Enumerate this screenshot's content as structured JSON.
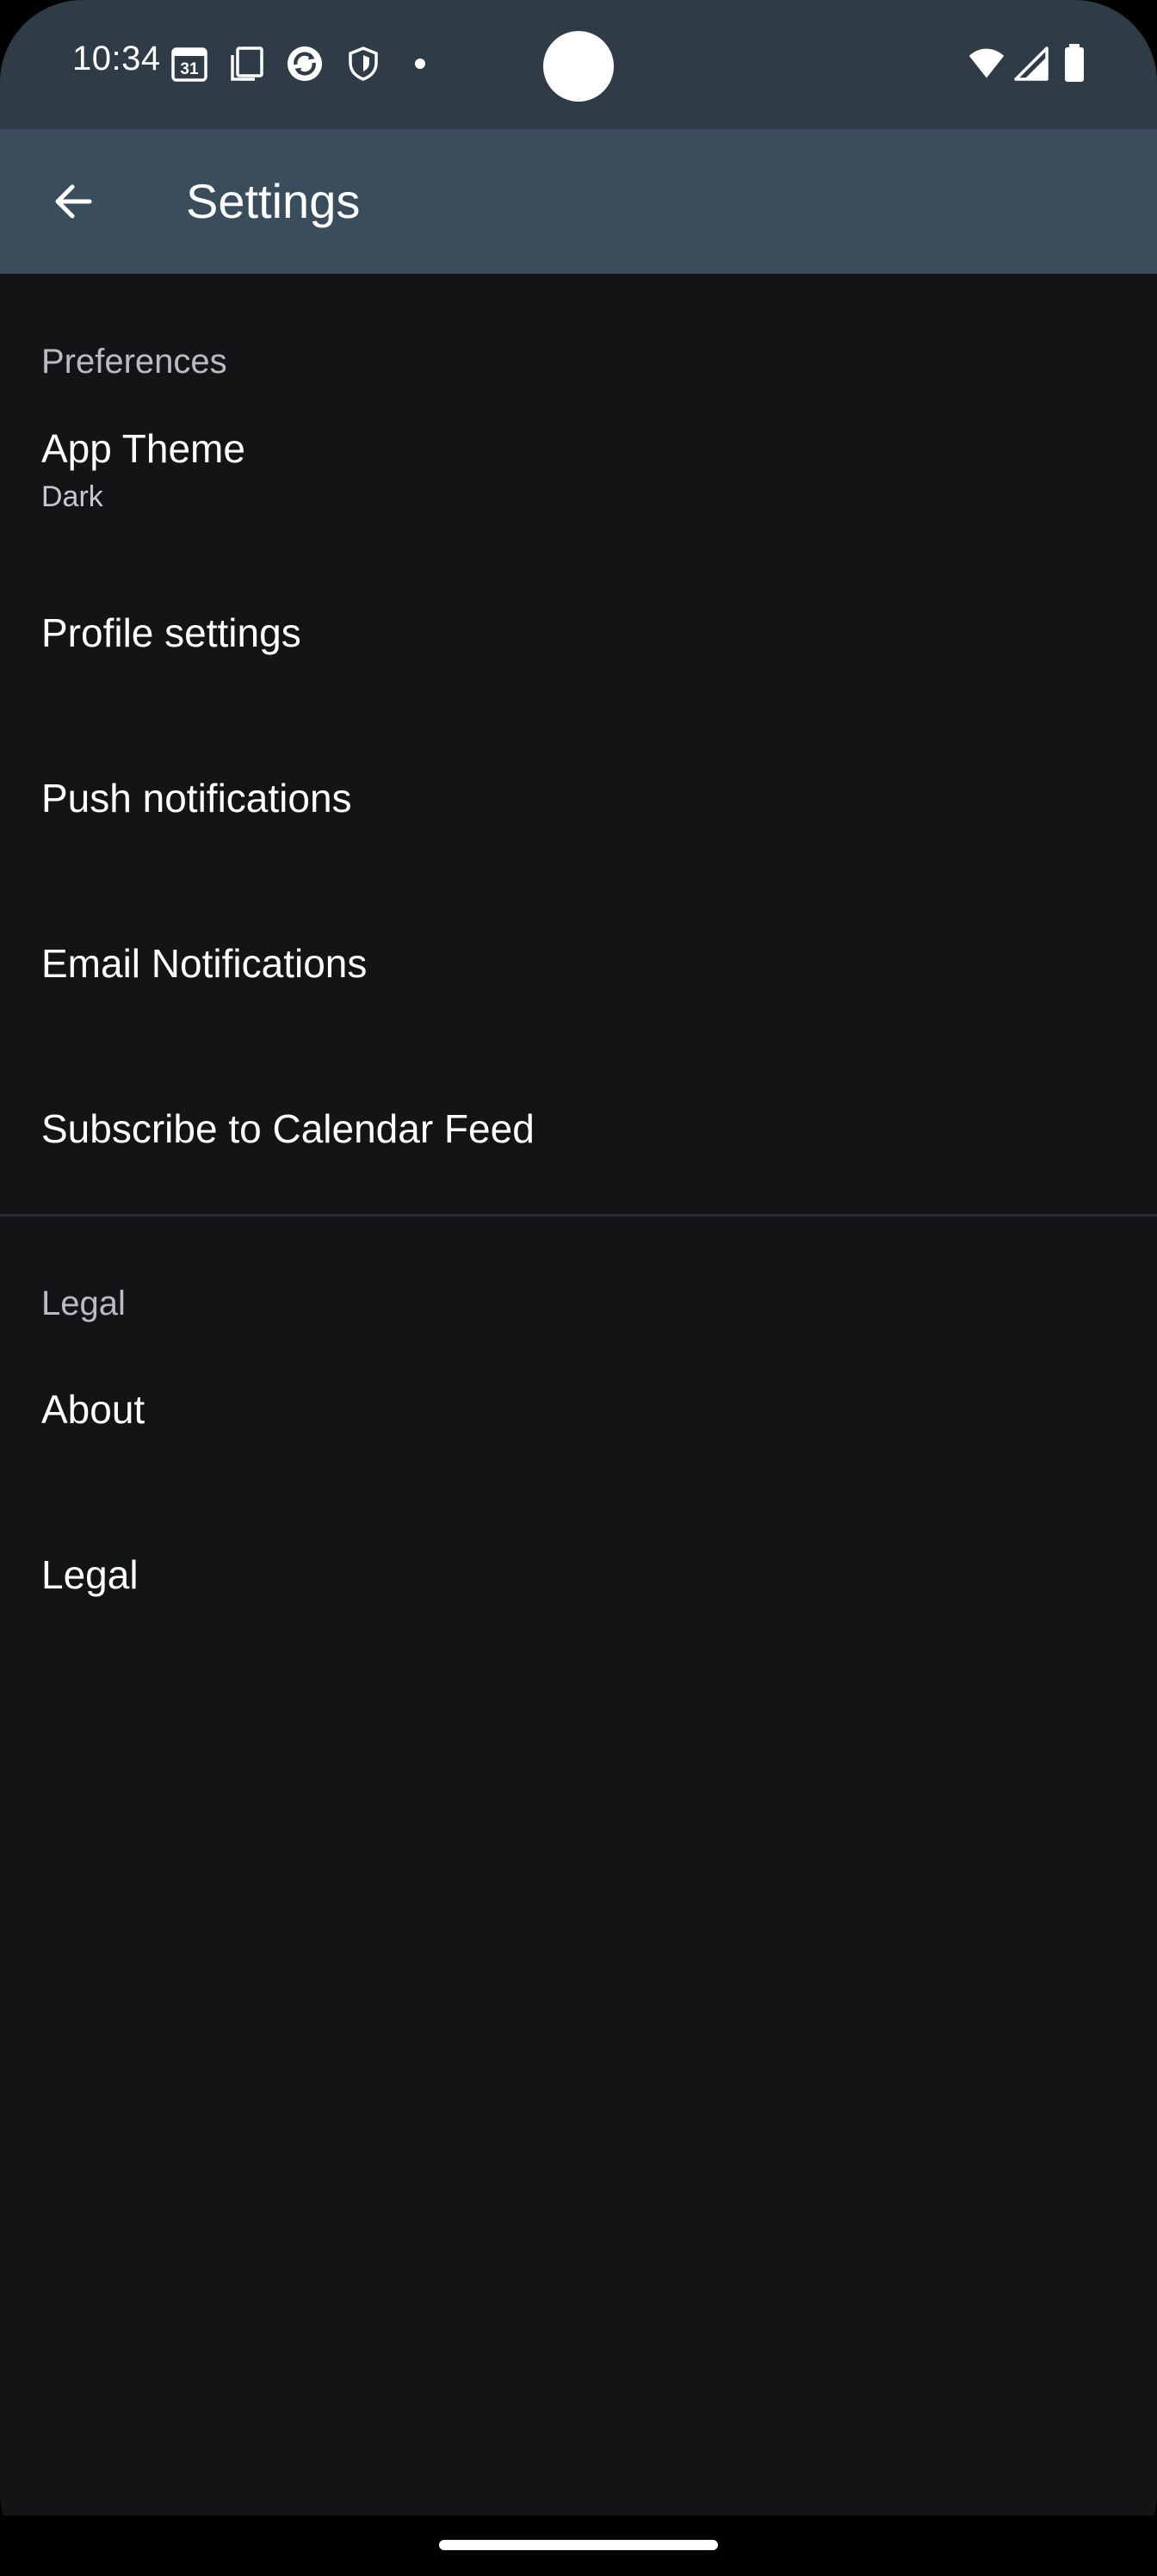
{
  "status_bar": {
    "time": "10:34",
    "calendar_date": "31",
    "icons": [
      "calendar-icon",
      "screenshot-icon",
      "sync-app-icon",
      "shield-icon",
      "notification-dot-icon",
      "wifi-icon",
      "signal-icon",
      "battery-icon"
    ]
  },
  "app_bar": {
    "title": "Settings",
    "back_icon": "arrow-back-icon"
  },
  "sections": {
    "preferences": {
      "header": "Preferences",
      "items": [
        {
          "title": "App Theme",
          "summary": "Dark"
        },
        {
          "title": "Profile settings"
        },
        {
          "title": "Push notifications"
        },
        {
          "title": "Email Notifications"
        },
        {
          "title": "Subscribe to Calendar Feed"
        }
      ]
    },
    "legal": {
      "header": "Legal",
      "items": [
        {
          "title": "About"
        },
        {
          "title": "Legal"
        }
      ]
    }
  },
  "colors": {
    "status_bar_bg": "#2f3c47",
    "app_bar_bg": "#3a4d5c",
    "background": "#131416",
    "section_header": "#b9bcbf",
    "text": "#ffffff"
  }
}
